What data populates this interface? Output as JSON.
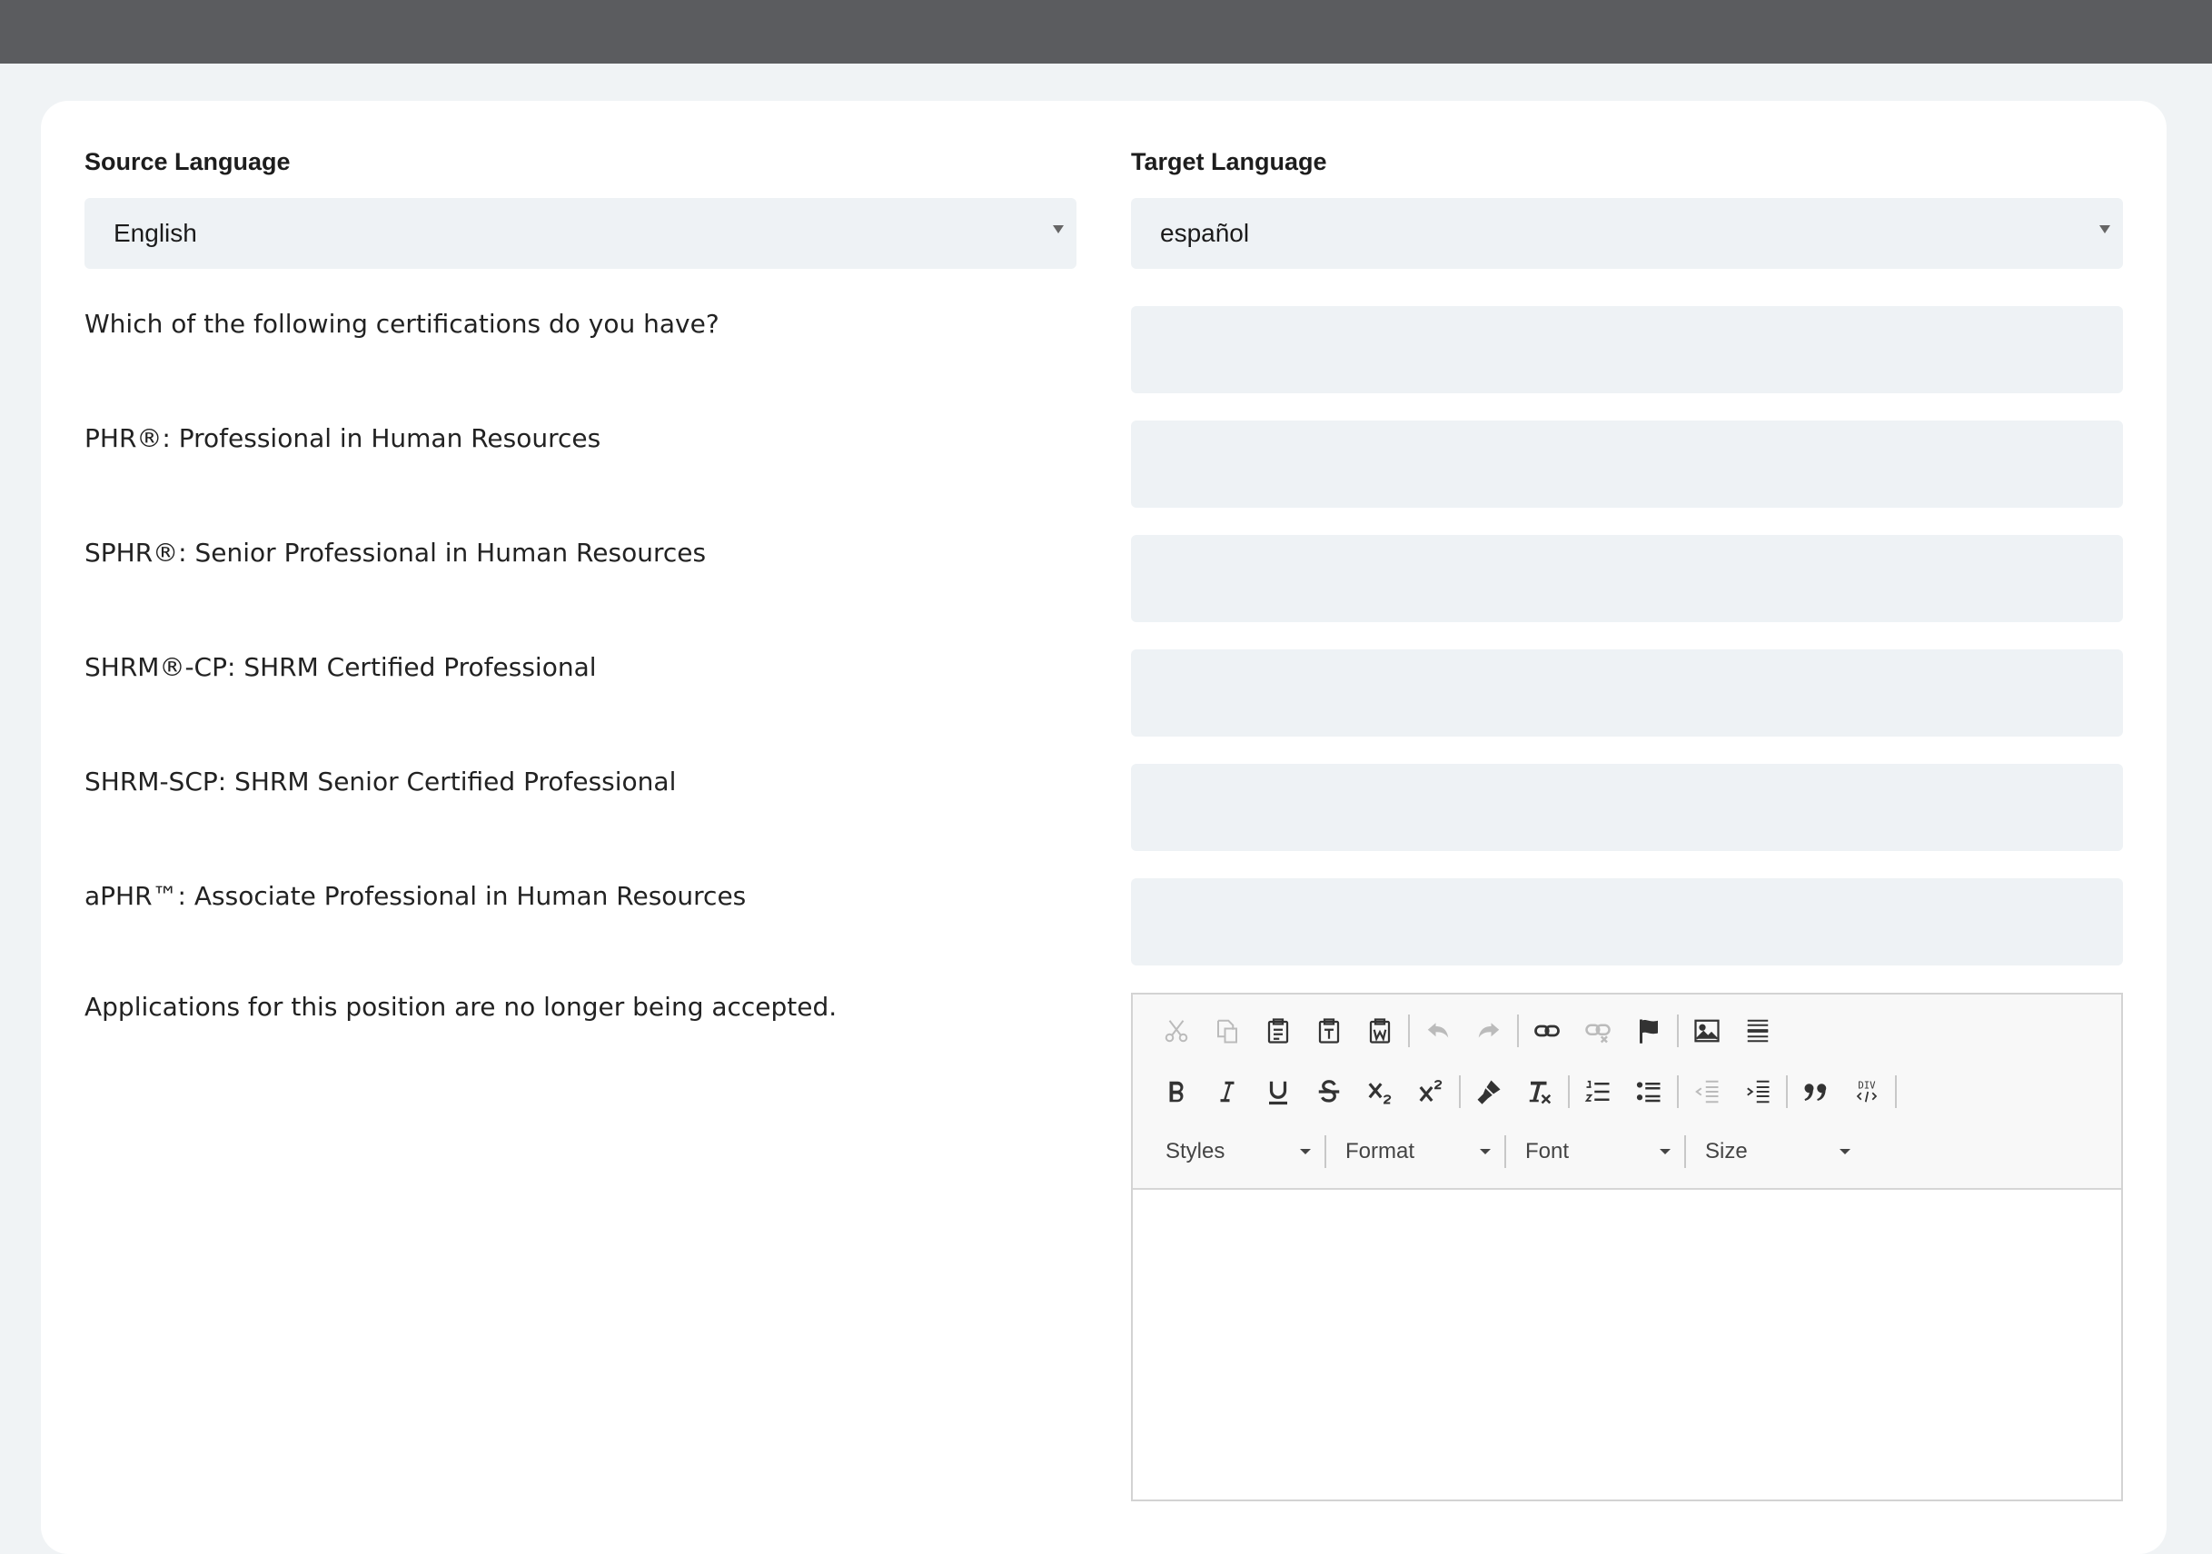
{
  "header": {},
  "source": {
    "label": "Source Language",
    "selected": "English"
  },
  "target": {
    "label": "Target Language",
    "selected": "español"
  },
  "rows": [
    {
      "text": "Which of the following certifications do you have?",
      "translation": ""
    },
    {
      "text": "PHR®: Professional in Human Resources",
      "translation": ""
    },
    {
      "text": "SPHR®: Senior Professional in Human Resources",
      "translation": ""
    },
    {
      "text": "SHRM®-CP: SHRM Certified Professional",
      "translation": ""
    },
    {
      "text": "SHRM-SCP: SHRM Senior Certified Professional",
      "translation": ""
    },
    {
      "text": "aPHR™: Associate Professional in Human Resources",
      "translation": ""
    }
  ],
  "last_row": {
    "text": "Applications for this position are no longer being accepted."
  },
  "editor": {
    "row1_icons": [
      "cut-icon",
      "copy-icon",
      "paste-icon",
      "paste-text-icon",
      "paste-word-icon",
      "undo-icon",
      "redo-icon",
      "link-icon",
      "unlink-icon",
      "anchor-flag-icon",
      "image-icon",
      "horizontal-rule-icon"
    ],
    "row2_icons": [
      "bold-icon",
      "italic-icon",
      "underline-icon",
      "strikethrough-icon",
      "subscript-icon",
      "superscript-icon",
      "copy-format-icon",
      "remove-format-icon",
      "numbered-list-icon",
      "bulleted-list-icon",
      "outdent-icon",
      "indent-icon",
      "blockquote-icon",
      "div-container-icon"
    ],
    "combos": {
      "styles": "Styles",
      "format": "Format",
      "font": "Font",
      "size": "Size"
    },
    "div_label": "DIV"
  }
}
